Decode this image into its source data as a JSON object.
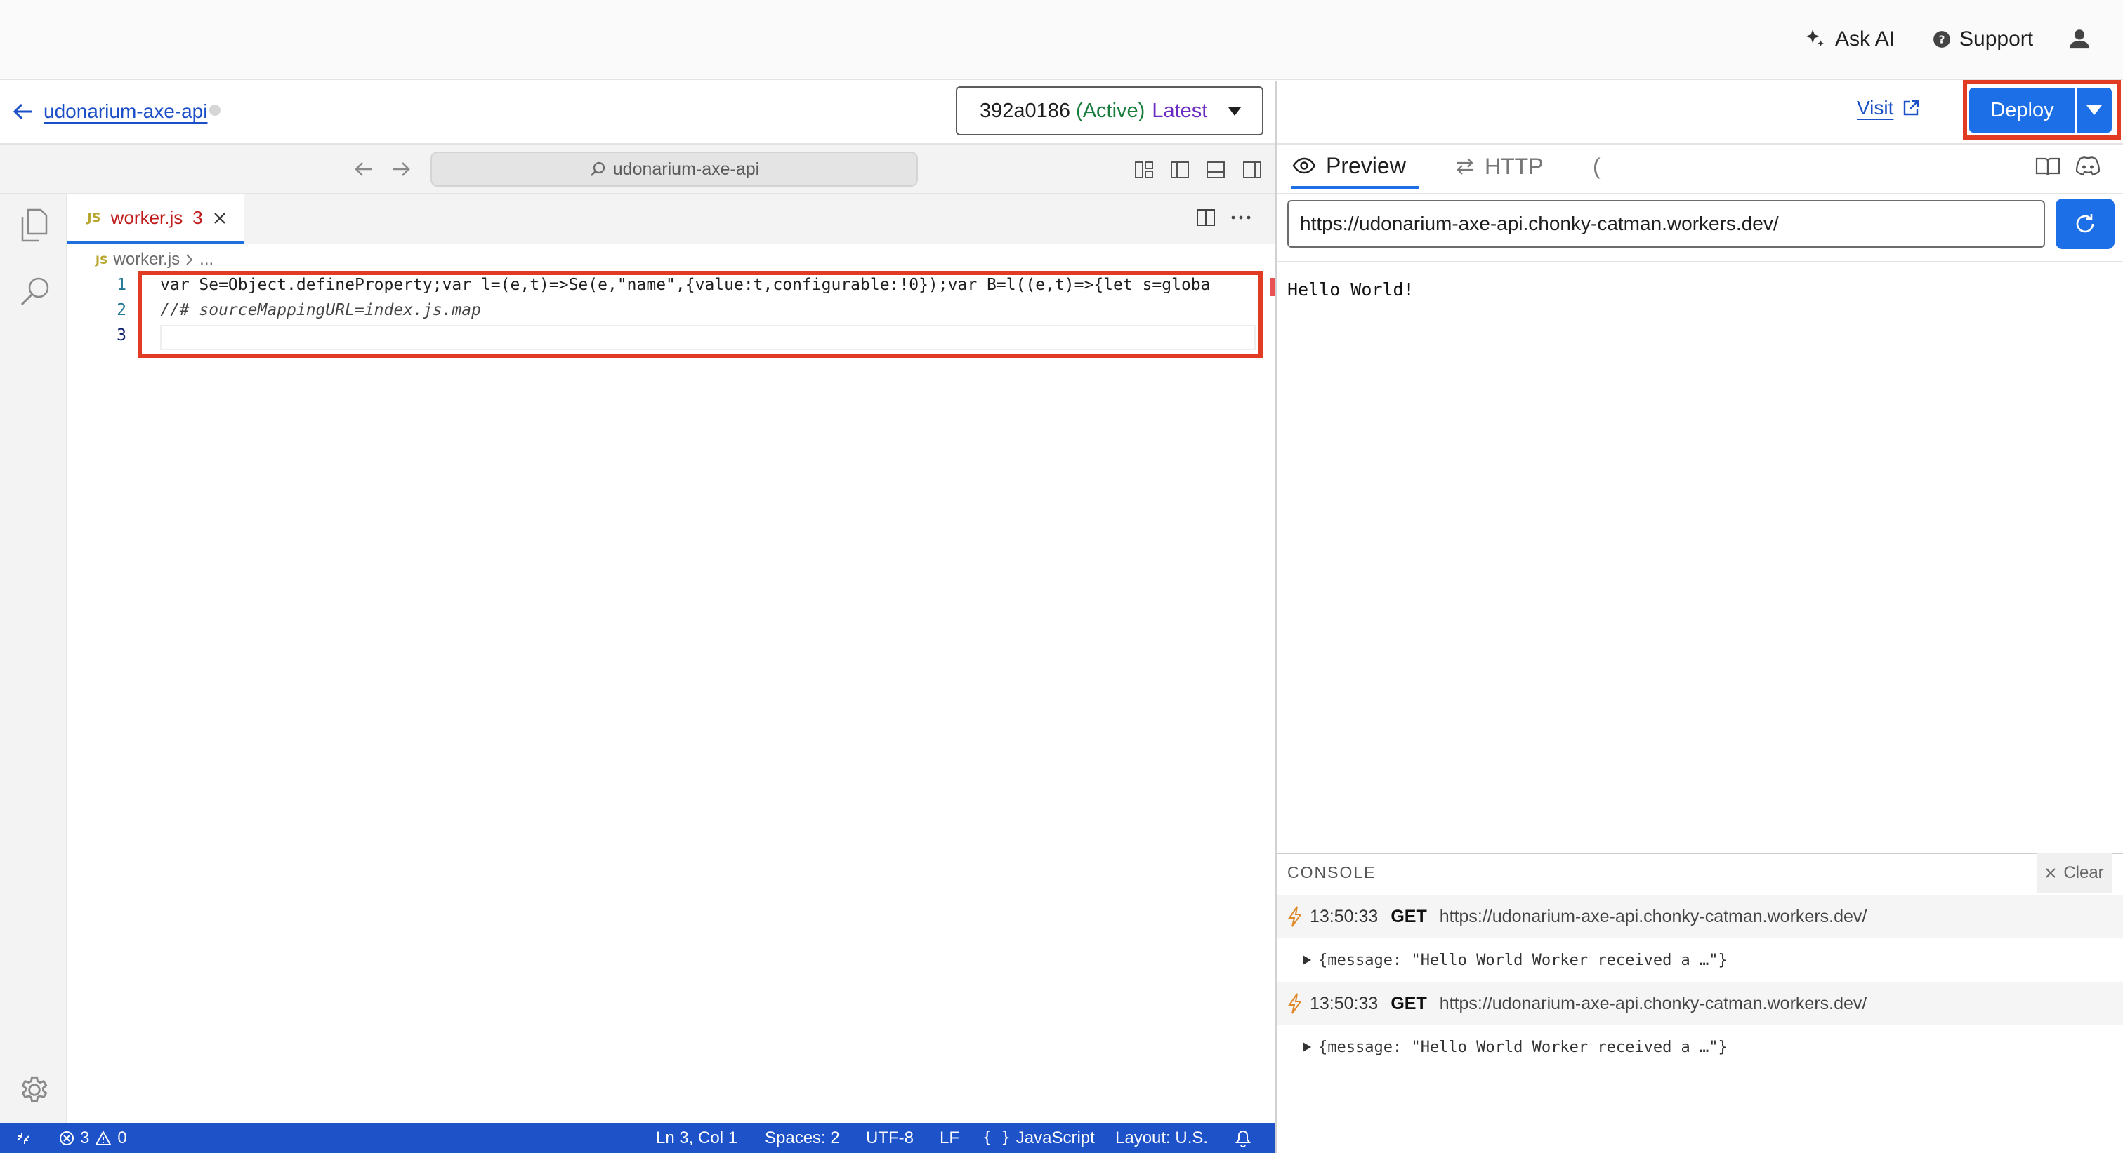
{
  "topbar": {
    "ask_ai": "Ask AI",
    "support": "Support"
  },
  "editor_header": {
    "back_label": "udonarium-axe-api",
    "version": {
      "id": "392a0186",
      "status": "(Active)",
      "tag": "Latest"
    }
  },
  "vscode": {
    "command_center": "udonarium-axe-api",
    "tab": {
      "badge": "JS",
      "name": "worker.js",
      "problems": "3"
    },
    "breadcrumb": {
      "badge": "JS",
      "file": "worker.js",
      "rest": "..."
    },
    "code": [
      {
        "num": "1",
        "text": "var Se=Object.defineProperty;var l=(e,t)=>Se(e,\"name\",{value:t,configurable:!0});var B=l((e,t)=>{let s=globa"
      },
      {
        "num": "2",
        "text": "//# sourceMappingURL=index.js.map"
      },
      {
        "num": "3",
        "text": ""
      }
    ],
    "status": {
      "errors": "3",
      "warnings": "0",
      "position": "Ln 3, Col 1",
      "spaces": "Spaces: 2",
      "encoding": "UTF-8",
      "eol": "LF",
      "language": "JavaScript",
      "layout": "Layout: U.S."
    }
  },
  "right": {
    "visit": "Visit",
    "deploy": "Deploy",
    "tabs": {
      "preview": "Preview",
      "http": "HTTP",
      "more": "("
    },
    "url": "https://udonarium-axe-api.chonky-catman.workers.dev/",
    "output": "Hello World!",
    "console": {
      "title": "CONSOLE",
      "clear": "Clear",
      "logs": [
        {
          "time": "13:50:33",
          "method": "GET",
          "url": "https://udonarium-axe-api.chonky-catman.workers.dev/",
          "body": "{message: \"Hello World Worker received a …\"}"
        },
        {
          "time": "13:50:33",
          "method": "GET",
          "url": "https://udonarium-axe-api.chonky-catman.workers.dev/",
          "body": "{message: \"Hello World Worker received a …\"}"
        }
      ]
    }
  },
  "colors": {
    "accent": "#1d6fe8",
    "statusbar": "#1d52c9",
    "highlight": "#e23b24"
  }
}
